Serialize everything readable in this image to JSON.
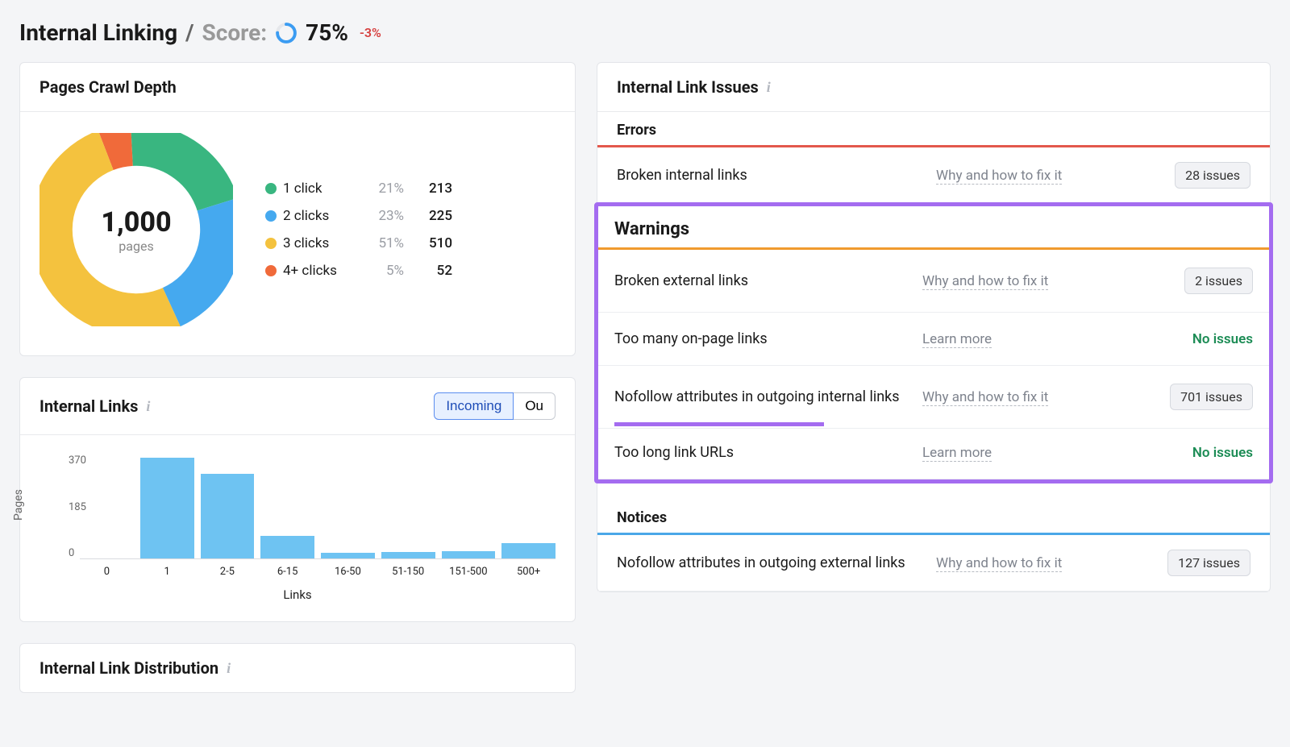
{
  "header": {
    "title": "Internal Linking",
    "separator": "/",
    "score_label": "Score:",
    "score_value": "75%",
    "score_delta": "-3%",
    "score_ring_color": "#3b9cf2",
    "score_ring_pct": 75
  },
  "crawl_depth": {
    "title": "Pages Crawl Depth",
    "center_value": "1,000",
    "center_label": "pages",
    "segments": [
      {
        "label": "1 click",
        "pct": "21%",
        "value": "213",
        "color": "#39b680",
        "frac": 0.21
      },
      {
        "label": "2 clicks",
        "pct": "23%",
        "value": "225",
        "color": "#45a9ef",
        "frac": 0.23
      },
      {
        "label": "3 clicks",
        "pct": "51%",
        "value": "510",
        "color": "#f4c23e",
        "frac": 0.51
      },
      {
        "label": "4+ clicks",
        "pct": "5%",
        "value": "52",
        "color": "#f06a3a",
        "frac": 0.05
      }
    ]
  },
  "internal_links_chart": {
    "title": "Internal Links",
    "tab_incoming": "Incoming",
    "tab_outgoing": "Ou",
    "selected_tab": "incoming",
    "y_label": "Pages",
    "x_label": "Links",
    "y_ticks": [
      "370",
      "185",
      "0"
    ],
    "y_max": 370
  },
  "chart_data": {
    "type": "bar",
    "title": "Internal Links (Incoming)",
    "xlabel": "Links",
    "ylabel": "Pages",
    "ylim": [
      0,
      370
    ],
    "categories": [
      "0",
      "1",
      "2-5",
      "6-15",
      "16-50",
      "51-150",
      "151-500",
      "500+"
    ],
    "values": [
      0,
      360,
      300,
      80,
      20,
      22,
      25,
      55
    ]
  },
  "internal_link_distribution": {
    "title": "Internal Link Distribution"
  },
  "issues": {
    "title": "Internal Link Issues",
    "errors": {
      "heading": "Errors",
      "rows": [
        {
          "name": "Broken internal links",
          "help": "Why and how to fix it",
          "count_label": "28 issues",
          "has_count": true
        }
      ]
    },
    "warnings": {
      "heading": "Warnings",
      "rows": [
        {
          "name": "Broken external links",
          "help": "Why and how to fix it",
          "count_label": "2 issues",
          "has_count": true,
          "highlight": false
        },
        {
          "name": "Too many on-page links",
          "help": "Learn more",
          "count_label": "No issues",
          "has_count": false,
          "highlight": false
        },
        {
          "name": "Nofollow attributes in outgoing internal links",
          "help": "Why and how to fix it",
          "count_label": "701 issues",
          "has_count": true,
          "highlight": true
        },
        {
          "name": "Too long link URLs",
          "help": "Learn more",
          "count_label": "No issues",
          "has_count": false,
          "highlight": false
        }
      ]
    },
    "notices": {
      "heading": "Notices",
      "rows": [
        {
          "name": "Nofollow attributes in outgoing external links",
          "help": "Why and how to fix it",
          "count_label": "127 issues",
          "has_count": true
        }
      ]
    }
  }
}
